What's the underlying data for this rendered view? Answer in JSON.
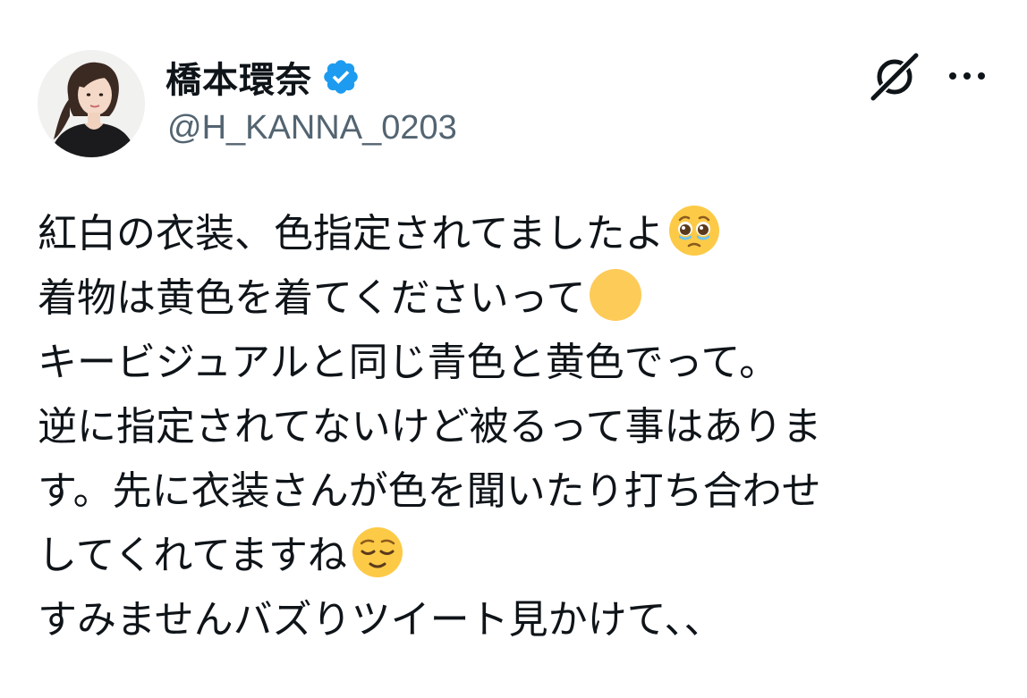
{
  "author": {
    "display_name": "橋本環奈",
    "handle": "@H_KANNA_0203",
    "verified": true,
    "verified_icon": "verified-badge-icon"
  },
  "actions": {
    "grok_icon": "grok-icon",
    "more_icon": "more-options-icon"
  },
  "tweet": {
    "lines": [
      "紅白の衣装、色指定されてましたよ",
      "着物は黄色を着てくださいって",
      "キービジュアルと同じ青色と黄色でって。",
      "逆に指定されてないけど被るって事はありま",
      "す。先に衣装さんが色を聞いたり打ち合わせ",
      "してくれてますね",
      "すみませんバズりツイート見かけて、、"
    ],
    "emojis": {
      "line1": "pleading-face-emoji",
      "line2": "yellow-circle-emoji",
      "line6": "relieved-face-emoji"
    }
  },
  "colors": {
    "text": "#0f1419",
    "handle": "#536471",
    "verified_blue": "#1d9bf0",
    "emoji_yellow": "#fdca47"
  }
}
